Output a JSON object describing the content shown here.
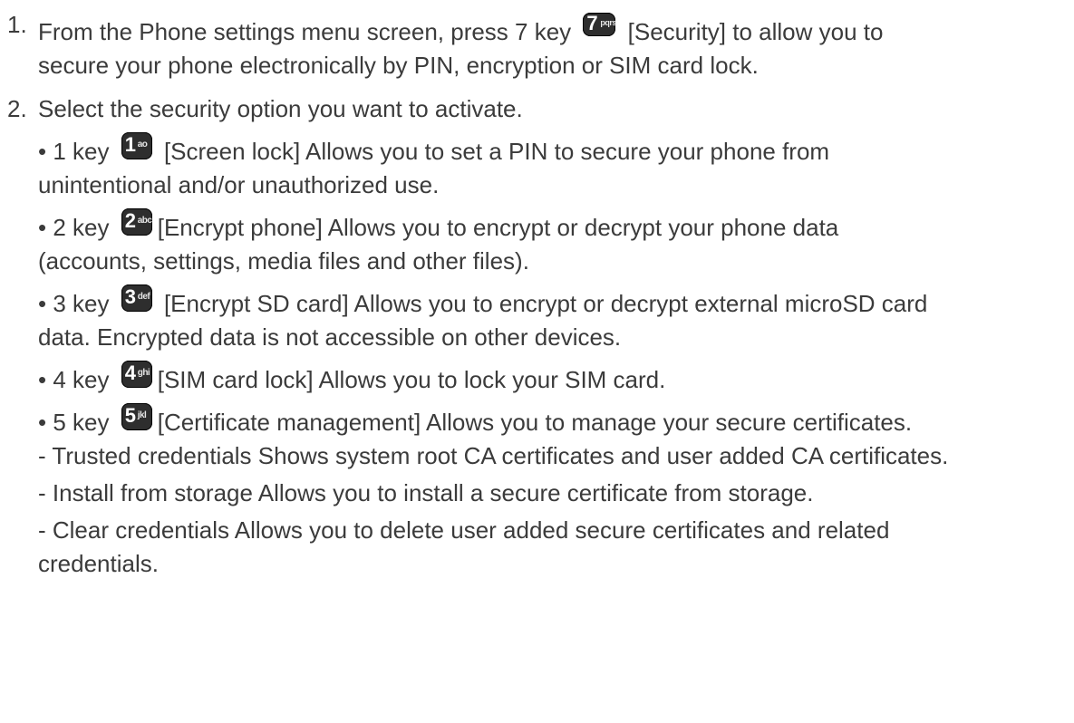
{
  "steps": [
    {
      "number": "1.",
      "lines": [
        "From the Phone settings menu screen, press 7 key",
        "[Security] to allow you to",
        "secure your phone electronically by PIN, encryption or SIM card lock."
      ],
      "key": {
        "digit": "7",
        "letters": "pqrs"
      }
    },
    {
      "number": "2.",
      "text": "Select the security option you want to activate."
    }
  ],
  "options": [
    {
      "prefix": "• 1 key",
      "key": {
        "digit": "1",
        "letters": "ao"
      },
      "line1": "[Screen lock] Allows you to set a PIN to secure your phone from",
      "line2": "unintentional and/or unauthorized use."
    },
    {
      "prefix": "• 2 key",
      "key": {
        "digit": "2",
        "letters": "abc"
      },
      "line1": "[Encrypt phone] Allows you to encrypt or decrypt your phone data",
      "line2": "(accounts, settings, media files and other files)."
    },
    {
      "prefix": "• 3 key",
      "key": {
        "digit": "3",
        "letters": "def"
      },
      "line1": "[Encrypt SD card] Allows you to encrypt or decrypt external microSD card",
      "line2": "data. Encrypted data is not accessible on other devices."
    },
    {
      "prefix": "• 4 key",
      "key": {
        "digit": "4",
        "letters": "ghi"
      },
      "line1": "[SIM card lock] Allows you to lock your SIM card."
    },
    {
      "prefix": "• 5 key",
      "key": {
        "digit": "5",
        "letters": "jkl"
      },
      "line1": "[Certificate management] Allows you to manage your secure certificates."
    }
  ],
  "certificate_items": [
    "- Trusted credentials Shows system root CA certificates and user added CA certificates.",
    "- Install from storage Allows you to install a secure certificate from storage.",
    "- Clear credentials Allows you to delete user added secure certificates and related",
    "credentials."
  ]
}
